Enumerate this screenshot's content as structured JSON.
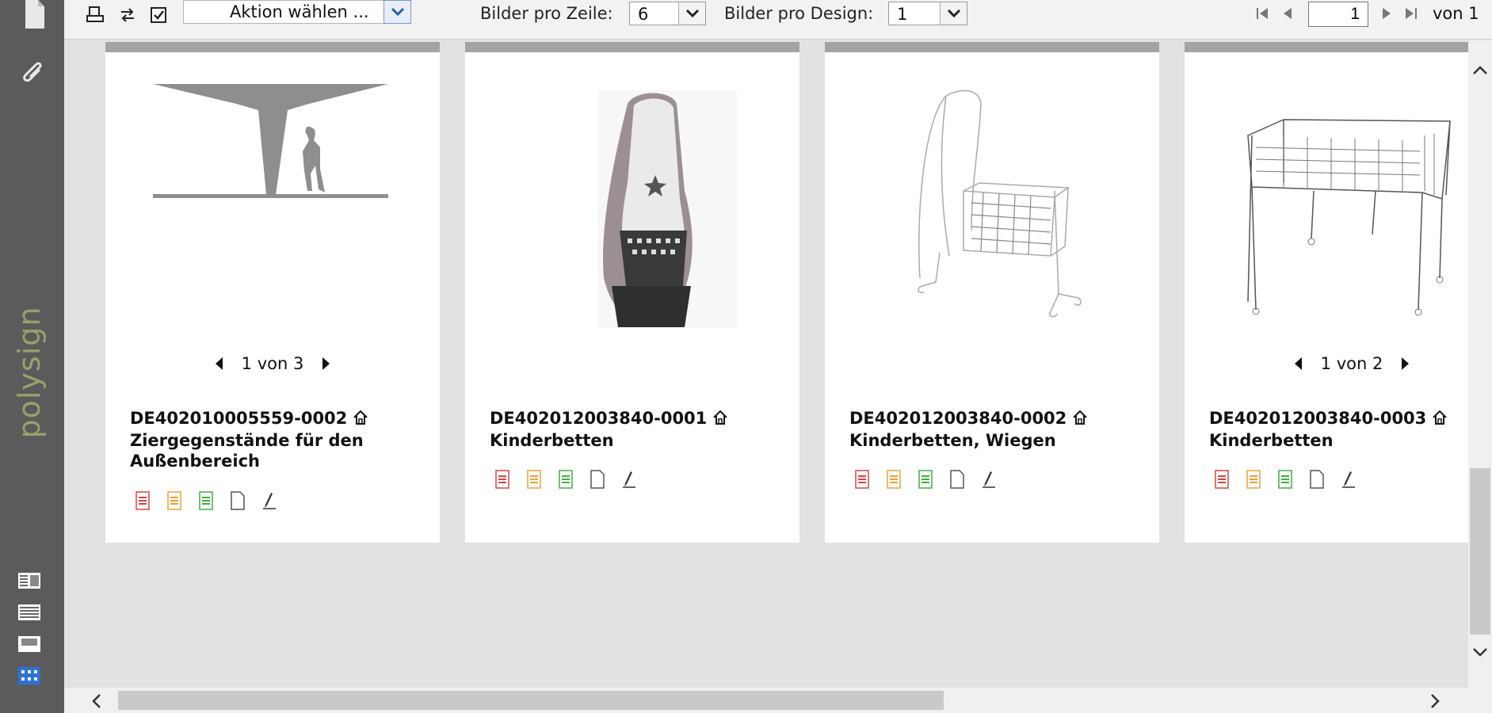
{
  "sidebar": {
    "brand": "polysign",
    "icons": [
      "document-icon",
      "paperclip-icon"
    ],
    "view_buttons": [
      "detail-view-icon",
      "list-view-icon",
      "single-view-icon",
      "grid-view-icon"
    ]
  },
  "toolbar": {
    "action_select": "Aktion wählen ...",
    "per_row_label": "Bilder pro Zeile:",
    "per_row_value": "6",
    "per_design_label": "Bilder pro Design:",
    "per_design_value": "1",
    "page_current": "1",
    "page_total": "von 1"
  },
  "cards": [
    {
      "code": "DE402010005559-0002",
      "title": "Ziergegenstände für den Außenbereich",
      "pager": "1 von 3",
      "image": "outdoor-ornament-drawing"
    },
    {
      "code": "DE402012003840-0001",
      "title": "Kinderbetten",
      "pager": "",
      "image": "canopy-crib-photo"
    },
    {
      "code": "DE402012003840-0002",
      "title": "Kinderbetten, Wiegen",
      "pager": "",
      "image": "cradle-sketch"
    },
    {
      "code": "DE402012003840-0003",
      "title": "Kinderbetten",
      "pager": "1 von 2",
      "image": "crib-sketch"
    }
  ],
  "colors": {
    "sidebar_bg": "#5b5b5b",
    "brand": "#9aa06a",
    "doc_red": "#e04040",
    "doc_orange": "#f0a030",
    "doc_green": "#40b040"
  }
}
